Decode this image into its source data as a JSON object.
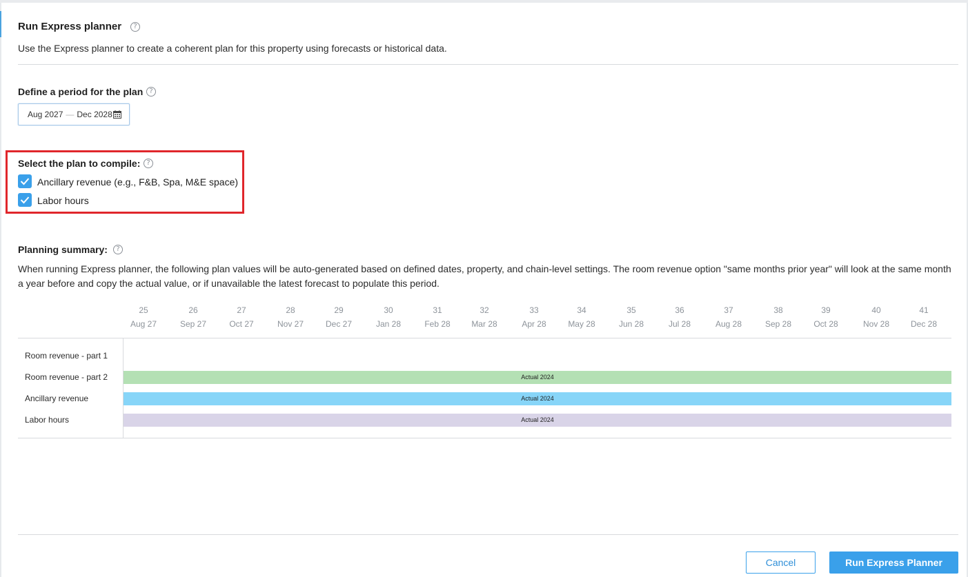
{
  "header": {
    "title": "Run Express planner",
    "intro": "Use the Express planner to create a coherent plan for this property using forecasts or historical data."
  },
  "period": {
    "label": "Define a period for the plan",
    "start": "Aug 2027",
    "separator": "—",
    "end": "Dec 2028",
    "icon": "calendar-icon"
  },
  "compile": {
    "label": "Select the plan to compile:",
    "options": [
      {
        "label": "Ancillary revenue (e.g., F&B, Spa, M&E space)",
        "checked": true
      },
      {
        "label": "Labor hours",
        "checked": true
      }
    ]
  },
  "summary": {
    "label": "Planning summary:",
    "description": "When running Express planner, the following plan values will be auto-generated based on defined dates, property, and chain-level settings. The room revenue option \"same months prior year\" will look at the same month a year before and copy the actual value, or if unavailable the latest forecast to populate this period."
  },
  "timeline": {
    "months": [
      {
        "week": "25",
        "month": "Aug 27"
      },
      {
        "week": "26",
        "month": "Sep 27"
      },
      {
        "week": "27",
        "month": "Oct 27"
      },
      {
        "week": "28",
        "month": "Nov 27"
      },
      {
        "week": "29",
        "month": "Dec 27"
      },
      {
        "week": "30",
        "month": "Jan 28"
      },
      {
        "week": "31",
        "month": "Feb 28"
      },
      {
        "week": "32",
        "month": "Mar 28"
      },
      {
        "week": "33",
        "month": "Apr 28"
      },
      {
        "week": "34",
        "month": "May 28"
      },
      {
        "week": "35",
        "month": "Jun 28"
      },
      {
        "week": "36",
        "month": "Jul 28"
      },
      {
        "week": "37",
        "month": "Aug 28"
      },
      {
        "week": "38",
        "month": "Sep 28"
      },
      {
        "week": "39",
        "month": "Oct 28"
      },
      {
        "week": "40",
        "month": "Nov 28"
      },
      {
        "week": "41",
        "month": "Dec 28"
      }
    ],
    "rows": [
      {
        "label": "Room revenue - part 1",
        "bar": null,
        "color": null
      },
      {
        "label": "Room revenue - part 2",
        "bar": "Actual 2024",
        "color": "#b4e0b4"
      },
      {
        "label": "Ancillary revenue",
        "bar": "Actual 2024",
        "color": "#87d5f8"
      },
      {
        "label": "Labor hours",
        "bar": "Actual 2024",
        "color": "#d9d4e8"
      }
    ]
  },
  "buttons": {
    "cancel": "Cancel",
    "run": "Run Express Planner"
  },
  "colors": {
    "accent": "#3aa0ea",
    "highlight_border": "#e0262b"
  }
}
